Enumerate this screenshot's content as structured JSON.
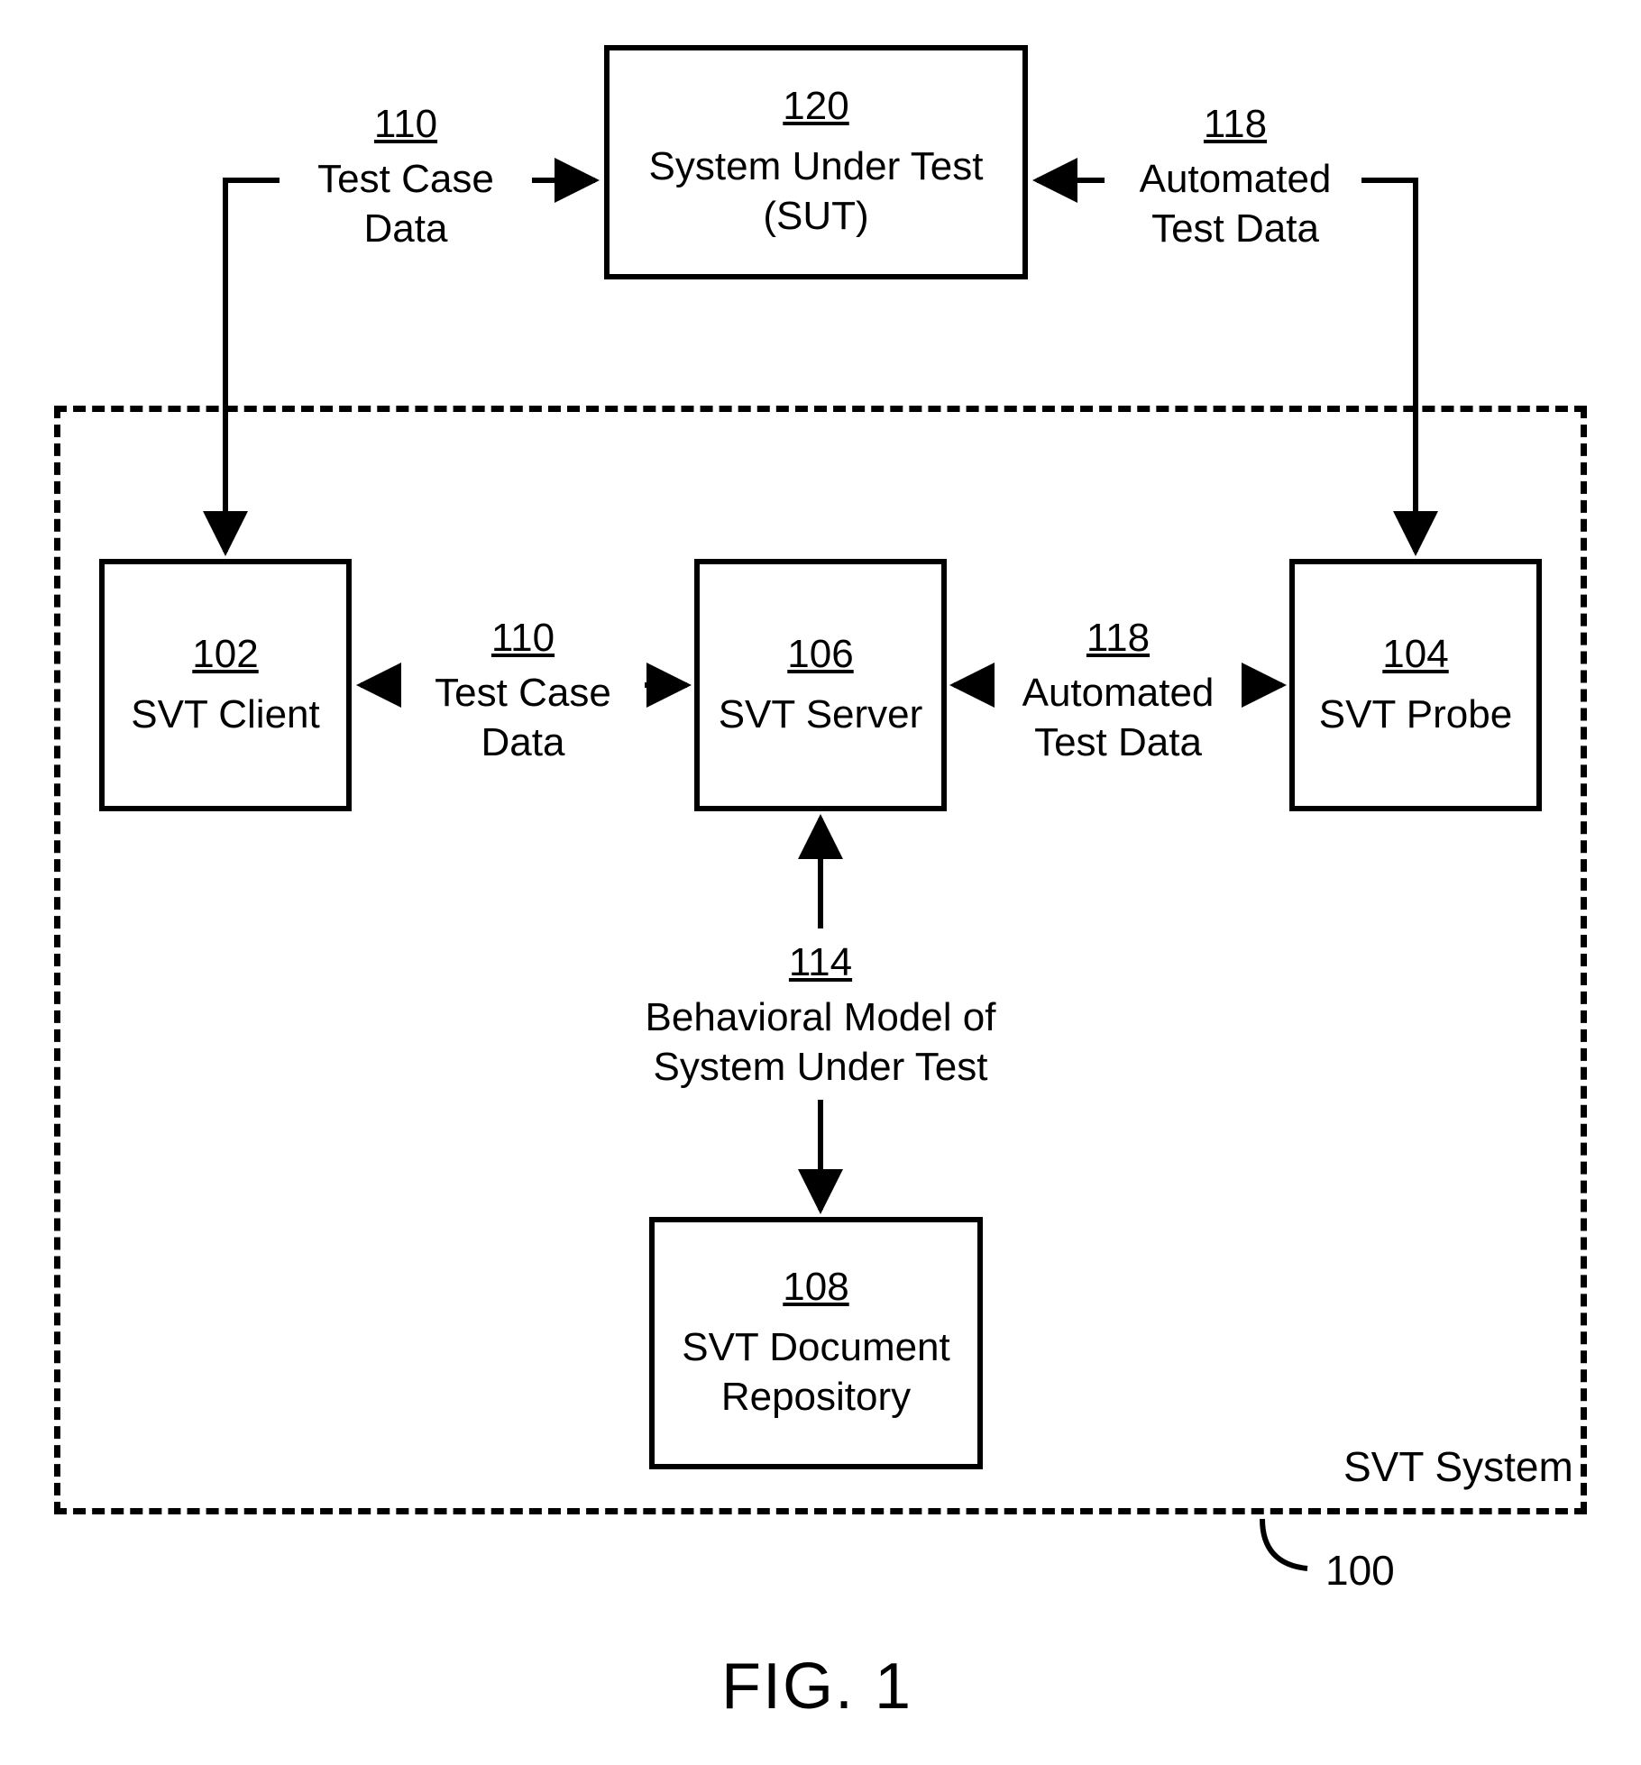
{
  "figure_label": "FIG. 1",
  "system_label": "SVT System",
  "system_ref": "100",
  "boxes": {
    "sut": {
      "ref": "120",
      "label": "System Under Test\n(SUT)"
    },
    "client": {
      "ref": "102",
      "label": "SVT Client"
    },
    "server": {
      "ref": "106",
      "label": "SVT Server"
    },
    "probe": {
      "ref": "104",
      "label": "SVT Probe"
    },
    "repo": {
      "ref": "108",
      "label": "SVT Document\nRepository"
    }
  },
  "edges": {
    "tcd_top": {
      "ref": "110",
      "label": "Test Case\nData"
    },
    "atd_top": {
      "ref": "118",
      "label": "Automated\nTest Data"
    },
    "tcd_mid": {
      "ref": "110",
      "label": "Test Case\nData"
    },
    "atd_mid": {
      "ref": "118",
      "label": "Automated\nTest Data"
    },
    "model": {
      "ref": "114",
      "label": "Behavioral Model of\nSystem Under Test"
    }
  }
}
